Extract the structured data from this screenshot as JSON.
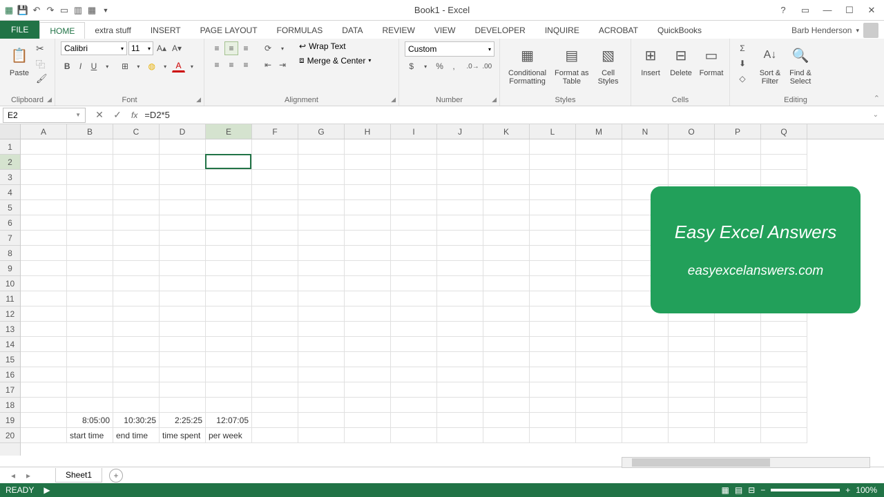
{
  "title": "Book1 - Excel",
  "user": "Barb Henderson",
  "tabs": {
    "file": "FILE",
    "home": "HOME",
    "extra": "extra stuff",
    "insert": "INSERT",
    "pagelayout": "PAGE LAYOUT",
    "formulas": "FORMULAS",
    "data": "DATA",
    "review": "REVIEW",
    "view": "VIEW",
    "developer": "DEVELOPER",
    "inquire": "INQUIRE",
    "acrobat": "ACROBAT",
    "quickbooks": "QuickBooks"
  },
  "ribbon": {
    "clipboard": {
      "paste": "Paste",
      "label": "Clipboard"
    },
    "font": {
      "name": "Calibri",
      "size": "11",
      "label": "Font"
    },
    "alignment": {
      "wrap": "Wrap Text",
      "merge": "Merge & Center",
      "label": "Alignment"
    },
    "number": {
      "format": "Custom",
      "label": "Number"
    },
    "styles": {
      "cond": "Conditional\nFormatting",
      "table": "Format as\nTable",
      "cell": "Cell\nStyles",
      "label": "Styles"
    },
    "cells": {
      "insert": "Insert",
      "delete": "Delete",
      "format": "Format",
      "label": "Cells"
    },
    "editing": {
      "sort": "Sort &\nFilter",
      "find": "Find &\nSelect",
      "label": "Editing"
    }
  },
  "namebox": "E2",
  "formula": "=D2*5",
  "columns": [
    "A",
    "B",
    "C",
    "D",
    "E",
    "F",
    "G",
    "H",
    "I",
    "J",
    "K",
    "L",
    "M",
    "N",
    "O",
    "P",
    "Q"
  ],
  "rows": 20,
  "grid": {
    "r1": {
      "B": "start time",
      "C": "end time",
      "D": "time spent",
      "E": "per week"
    },
    "r2": {
      "B": "8:05:00",
      "C": "10:30:25",
      "D": "2:25:25",
      "E": "12:07:05"
    }
  },
  "active": {
    "col": 4,
    "row": 1
  },
  "overlay": {
    "title": "Easy Excel Answers",
    "url": "easyexcelanswers.com"
  },
  "sheet": "Sheet1",
  "status": "READY",
  "zoom": "100%"
}
